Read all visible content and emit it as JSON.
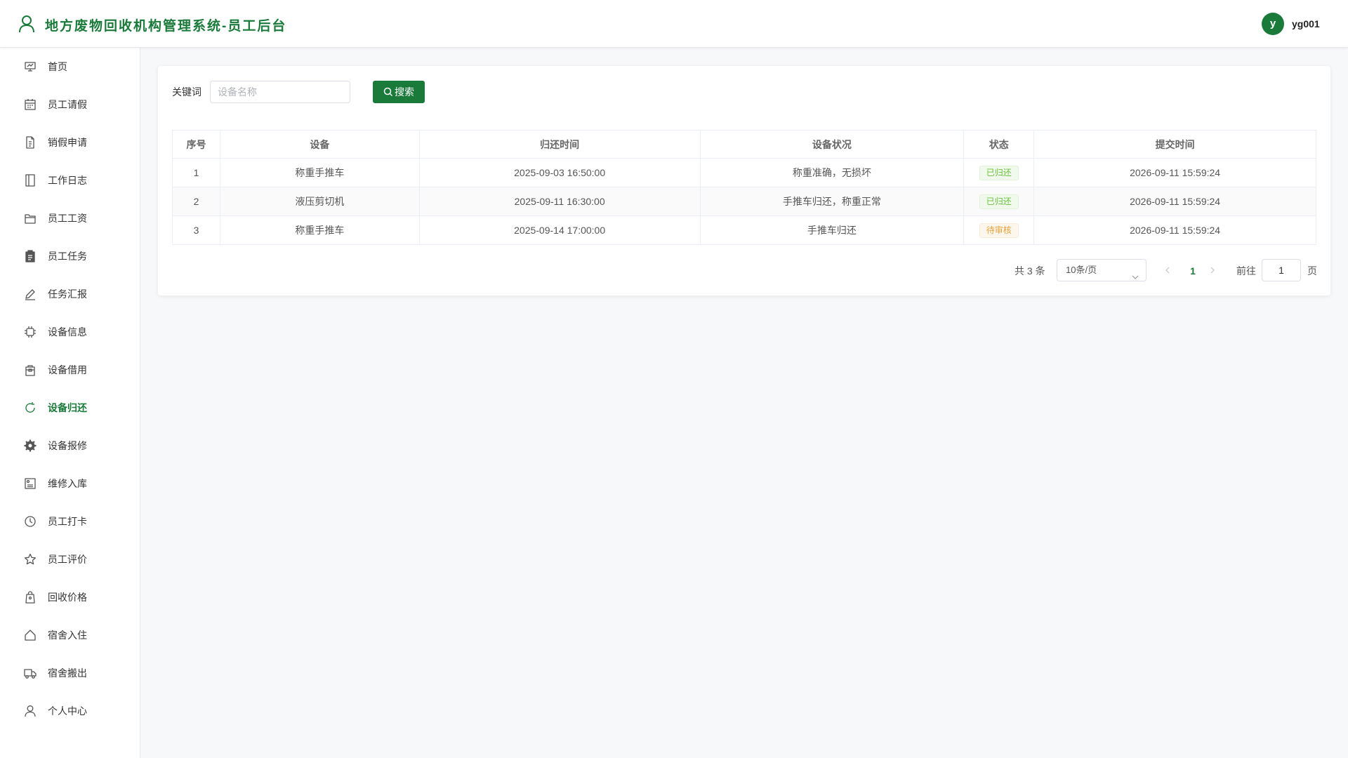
{
  "header": {
    "title": "地方废物回收机构管理系统-员工后台",
    "avatar_letter": "y",
    "username": "yg001",
    "brand_color": "#1a7a3a"
  },
  "sidebar": {
    "active_index": 9,
    "items": [
      {
        "label": "首页",
        "icon": "presentation-icon"
      },
      {
        "label": "员工请假",
        "icon": "calendar-icon"
      },
      {
        "label": "销假申请",
        "icon": "document-icon"
      },
      {
        "label": "工作日志",
        "icon": "notebook-icon"
      },
      {
        "label": "员工工资",
        "icon": "wallet-icon"
      },
      {
        "label": "员工任务",
        "icon": "clipboard-icon"
      },
      {
        "label": "任务汇报",
        "icon": "edit-pen-icon"
      },
      {
        "label": "设备信息",
        "icon": "chip-icon"
      },
      {
        "label": "设备借用",
        "icon": "bag-icon"
      },
      {
        "label": "设备归还",
        "icon": "refresh-icon"
      },
      {
        "label": "设备报修",
        "icon": "gear-icon"
      },
      {
        "label": "维修入库",
        "icon": "picture-icon"
      },
      {
        "label": "员工打卡",
        "icon": "clock-icon"
      },
      {
        "label": "员工评价",
        "icon": "star-icon"
      },
      {
        "label": "回收价格",
        "icon": "price-bag-icon"
      },
      {
        "label": "宿舍入住",
        "icon": "house-icon"
      },
      {
        "label": "宿舍搬出",
        "icon": "truck-icon"
      },
      {
        "label": "个人中心",
        "icon": "user-icon"
      }
    ]
  },
  "search": {
    "keyword_label": "关键词",
    "placeholder": "设备名称",
    "value": "",
    "button_label": "搜索"
  },
  "table": {
    "headers": [
      "序号",
      "设备",
      "归还时间",
      "设备状况",
      "状态",
      "提交时间"
    ],
    "rows": [
      {
        "index": "1",
        "device": "称重手推车",
        "return_time": "2025-09-03 16:50:00",
        "condition": "称重准确，无损坏",
        "status": "已归还",
        "status_type": "success",
        "submit_time": "2026-09-11 15:59:24"
      },
      {
        "index": "2",
        "device": "液压剪切机",
        "return_time": "2025-09-11 16:30:00",
        "condition": "手推车归还，称重正常",
        "status": "已归还",
        "status_type": "success",
        "submit_time": "2026-09-11 15:59:24"
      },
      {
        "index": "3",
        "device": "称重手推车",
        "return_time": "2025-09-14 17:00:00",
        "condition": "手推车归还",
        "status": "待审核",
        "status_type": "warning",
        "submit_time": "2026-09-11 15:59:24"
      }
    ]
  },
  "pagination": {
    "total_text": "共 3 条",
    "page_size": "10条/页",
    "current_page": "1",
    "goto_label": "前往",
    "goto_value": "1",
    "page_suffix": "页"
  }
}
